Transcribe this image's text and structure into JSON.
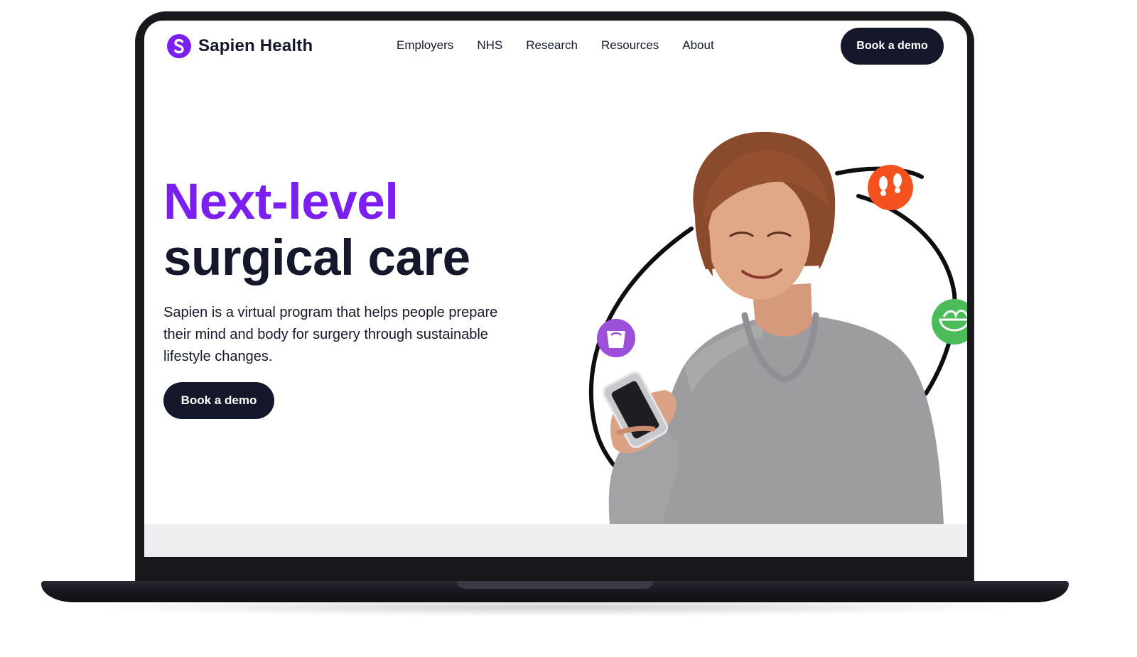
{
  "brand": {
    "name": "Sapien Health",
    "accent_color": "#7b1ff0",
    "dark_color": "#15182b"
  },
  "nav": {
    "items": [
      {
        "label": "Employers"
      },
      {
        "label": "NHS"
      },
      {
        "label": "Research"
      },
      {
        "label": "Resources"
      },
      {
        "label": "About"
      }
    ],
    "cta_label": "Book a demo"
  },
  "hero": {
    "title_line_1": "Next-level",
    "title_line_2": "surgical care",
    "description": "Sapien is a virtual program that helps people prepare their mind and body for surgery through sustainable lifestyle changes.",
    "cta_label": "Book a demo"
  },
  "illustration": {
    "icons": [
      {
        "name": "weight-scale-icon",
        "color": "#9c4fd9"
      },
      {
        "name": "footsteps-icon",
        "color": "#f4511e"
      },
      {
        "name": "salad-bowl-icon",
        "color": "#4cbb5a"
      }
    ]
  }
}
